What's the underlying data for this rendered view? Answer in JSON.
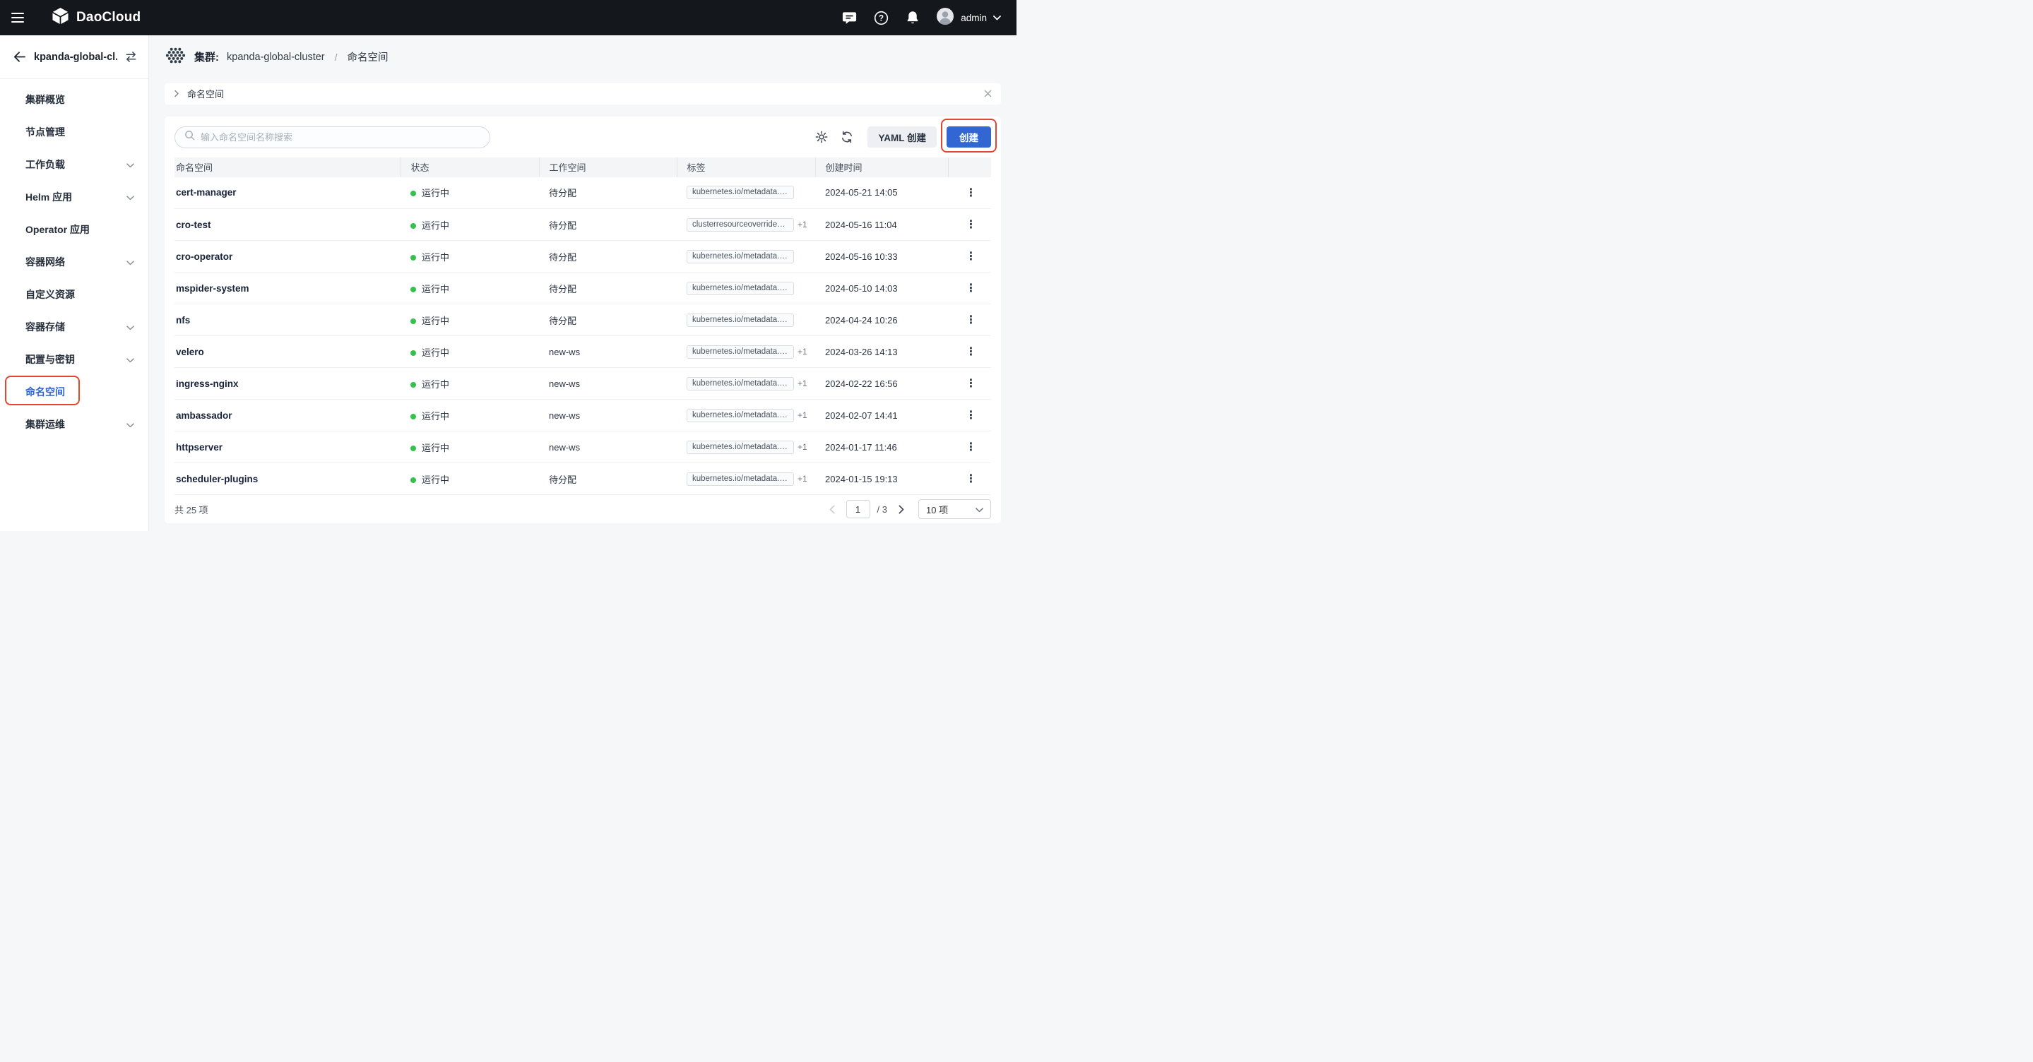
{
  "topbar": {
    "brand": "DaoCloud",
    "user": "admin"
  },
  "sidebar": {
    "cluster_name": "kpanda-global-cl...",
    "items": [
      {
        "label": "集群概览",
        "expandable": false
      },
      {
        "label": "节点管理",
        "expandable": false
      },
      {
        "label": "工作负载",
        "expandable": true
      },
      {
        "label": "Helm 应用",
        "expandable": true
      },
      {
        "label": "Operator 应用",
        "expandable": false
      },
      {
        "label": "容器网络",
        "expandable": true
      },
      {
        "label": "自定义资源",
        "expandable": false
      },
      {
        "label": "容器存储",
        "expandable": true
      },
      {
        "label": "配置与密钥",
        "expandable": true
      },
      {
        "label": "命名空间",
        "expandable": false,
        "active": true
      },
      {
        "label": "集群运维",
        "expandable": true
      }
    ]
  },
  "breadcrumb": {
    "prefix": "集群:",
    "cluster": "kpanda-global-cluster",
    "separator": "/",
    "current": "命名空间"
  },
  "panel": {
    "title": "命名空间"
  },
  "toolbar": {
    "search_placeholder": "输入命名空间名称搜索",
    "yaml_create": "YAML 创建",
    "create": "创建"
  },
  "table": {
    "columns": [
      "命名空间",
      "状态",
      "工作空间",
      "标签",
      "创建时间"
    ],
    "rows": [
      {
        "name": "cert-manager",
        "status": "运行中",
        "workspace": "待分配",
        "label": "kubernetes.io/metadata.nam...",
        "extra": "",
        "created": "2024-05-21 14:05"
      },
      {
        "name": "cro-test",
        "status": "运行中",
        "workspace": "待分配",
        "label": "clusterresourceoverrides....",
        "extra": "+1",
        "created": "2024-05-16 11:04"
      },
      {
        "name": "cro-operator",
        "status": "运行中",
        "workspace": "待分配",
        "label": "kubernetes.io/metadata.nam...",
        "extra": "",
        "created": "2024-05-16 10:33"
      },
      {
        "name": "mspider-system",
        "status": "运行中",
        "workspace": "待分配",
        "label": "kubernetes.io/metadata.nam...",
        "extra": "",
        "created": "2024-05-10 14:03"
      },
      {
        "name": "nfs",
        "status": "运行中",
        "workspace": "待分配",
        "label": "kubernetes.io/metadata.nam...",
        "extra": "",
        "created": "2024-04-24 10:26"
      },
      {
        "name": "velero",
        "status": "运行中",
        "workspace": "new-ws",
        "label": "kubernetes.io/metadata.n...",
        "extra": "+1",
        "created": "2024-03-26 14:13"
      },
      {
        "name": "ingress-nginx",
        "status": "运行中",
        "workspace": "new-ws",
        "label": "kubernetes.io/metadata.n...",
        "extra": "+1",
        "created": "2024-02-22 16:56"
      },
      {
        "name": "ambassador",
        "status": "运行中",
        "workspace": "new-ws",
        "label": "kubernetes.io/metadata.n...",
        "extra": "+1",
        "created": "2024-02-07 14:41"
      },
      {
        "name": "httpserver",
        "status": "运行中",
        "workspace": "new-ws",
        "label": "kubernetes.io/metadata.n...",
        "extra": "+1",
        "created": "2024-01-17 11:46"
      },
      {
        "name": "scheduler-plugins",
        "status": "运行中",
        "workspace": "待分配",
        "label": "kubernetes.io/metadata.n...",
        "extra": "+1",
        "created": "2024-01-15 19:13"
      }
    ]
  },
  "footer": {
    "total": "共 25 项",
    "page": "1",
    "page_total": "/ 3",
    "page_size": "10 项"
  },
  "icons": {
    "kebab": "⋮"
  },
  "colors": {
    "primary": "#3166d3",
    "annotation_red": "#e2472e",
    "status_running_green": "#34c24d",
    "topbar_bg": "#14181d"
  }
}
